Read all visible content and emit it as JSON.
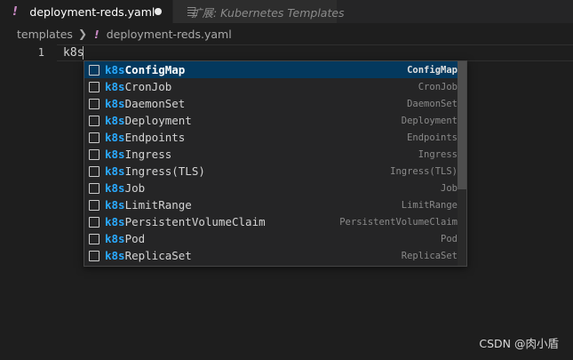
{
  "tabs": [
    {
      "label": "deployment-reds.yaml",
      "icon": "yaml-exclamation-icon",
      "modified": true,
      "active": true
    },
    {
      "label": "扩展: Kubernetes Templates",
      "icon": "preview-icon",
      "active": false
    }
  ],
  "breadcrumb": {
    "folder": "templates",
    "file": "deployment-reds.yaml"
  },
  "editor": {
    "line_number": "1",
    "code": "k8s"
  },
  "suggest": {
    "match_prefix": "k8s",
    "items": [
      {
        "rest": "ConfigMap",
        "detail": "ConfigMap"
      },
      {
        "rest": "CronJob",
        "detail": "CronJob"
      },
      {
        "rest": "DaemonSet",
        "detail": "DaemonSet"
      },
      {
        "rest": "Deployment",
        "detail": "Deployment"
      },
      {
        "rest": "Endpoints",
        "detail": "Endpoints"
      },
      {
        "rest": "Ingress",
        "detail": "Ingress"
      },
      {
        "rest": "Ingress(TLS)",
        "detail": "Ingress(TLS)"
      },
      {
        "rest": "Job",
        "detail": "Job"
      },
      {
        "rest": "LimitRange",
        "detail": "LimitRange"
      },
      {
        "rest": "PersistentVolumeClaim",
        "detail": "PersistentVolumeClaim"
      },
      {
        "rest": "Pod",
        "detail": "Pod"
      },
      {
        "rest": "ReplicaSet",
        "detail": "ReplicaSet"
      }
    ],
    "selected_index": 0
  },
  "watermark": "CSDN @肉小盾",
  "colors": {
    "background": "#1e1e1e",
    "match_highlight": "#2aaaff",
    "selected_row": "#04395e",
    "yaml_icon": "#c586c0"
  }
}
